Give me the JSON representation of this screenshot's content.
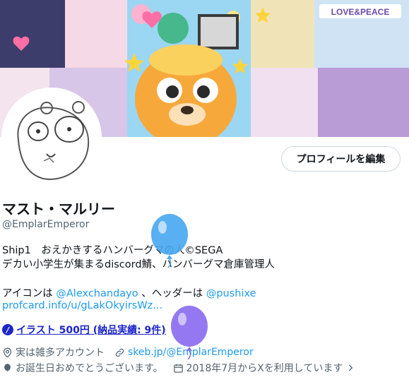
{
  "profile": {
    "edit_button_label": "プロフィールを編集",
    "display_name": "マスト・マルリー",
    "handle": "@EmplarEmperor"
  },
  "bio": {
    "line1": "Ship1　おえかきするハンバーグマの人©SEGA",
    "line2": "デカい小学生が集まるdiscord鯖、ハンバーグマ倉庫管理人",
    "line3_prefix": "アイコンは ",
    "line3_link1": "@Alexchandayo",
    "line3_mid": " 、ヘッダーは ",
    "line3_link2": "@pushixe",
    "line4_link": "profcard.info/u/gLakOkyirsWz",
    "line4_suffix": "..."
  },
  "pricing": {
    "label": "イラスト 500円 (納品実績: 9件)"
  },
  "meta": {
    "location": "実は雑多アカウント",
    "website": "skeb.jp/@EmplarEmperor",
    "birthday": "お誕生日おめでとうございます。",
    "joined": "2018年7月からXを利用しています"
  },
  "banner": {
    "sign_text": "LOVE&PEACE"
  },
  "colors": {
    "link": "#1d9bf0",
    "muted": "#536471",
    "pricing": "#1d26c9",
    "balloon_blue": "#4aa8f0",
    "balloon_purple": "#8a6cf0"
  }
}
